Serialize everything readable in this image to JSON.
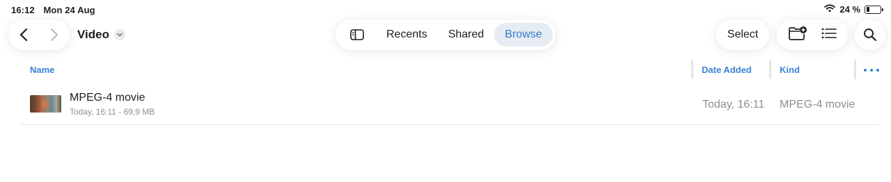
{
  "status_bar": {
    "time": "16:12",
    "date": "Mon 24 Aug",
    "battery_percent": "24 %",
    "battery_level": 0.24
  },
  "nav": {
    "back_icon": "chevron-left-icon",
    "forward_icon": "chevron-right-icon",
    "title": "Video"
  },
  "tabs": {
    "items": [
      {
        "label": "Recents",
        "active": false
      },
      {
        "label": "Shared",
        "active": false
      },
      {
        "label": "Browse",
        "active": true
      }
    ]
  },
  "toolbar": {
    "select_label": "Select"
  },
  "columns": {
    "name": "Name",
    "date_added": "Date Added",
    "kind": "Kind"
  },
  "files": [
    {
      "name": "MPEG-4 movie",
      "meta": "Today, 16:11 - 69,9 MB",
      "date_added": "Today, 16:11",
      "kind": "MPEG-4 movie"
    }
  ],
  "colors": {
    "accent": "#3478c6",
    "active_tab_bg": "#e6ecf4",
    "secondary_text": "#8e8e93"
  }
}
